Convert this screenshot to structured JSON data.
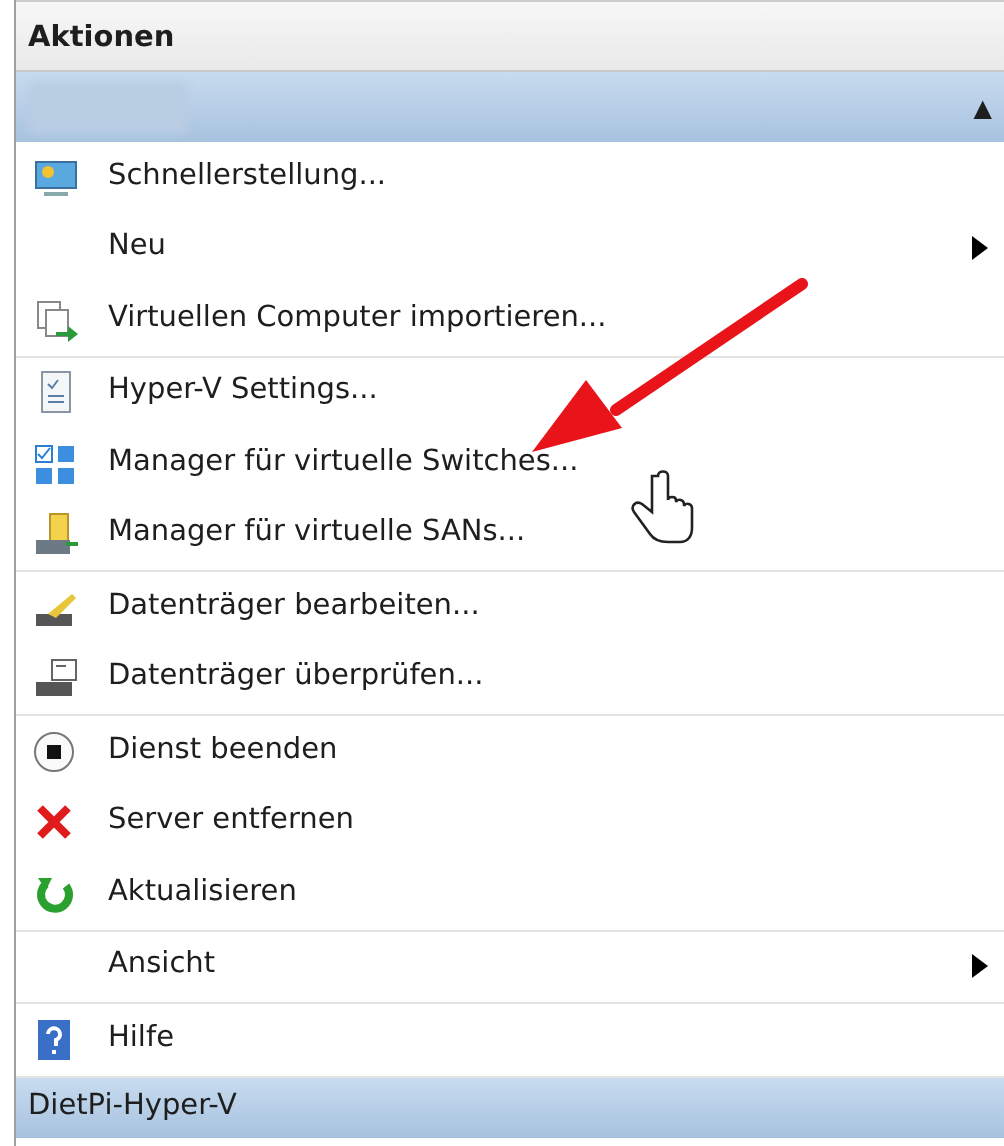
{
  "panel": {
    "title": "Aktionen"
  },
  "section": {
    "expanded": true,
    "toggle": "▲"
  },
  "groups": [
    {
      "items": [
        {
          "label": "Schnellerstellung...",
          "submenu": false
        },
        {
          "label": "Neu",
          "submenu": true
        },
        {
          "label": "Virtuellen Computer importieren...",
          "submenu": false
        }
      ]
    },
    {
      "items": [
        {
          "label": "Hyper-V Settings...",
          "submenu": false
        },
        {
          "label": "Manager für virtuelle Switches...",
          "submenu": false
        },
        {
          "label": "Manager für virtuelle SANs...",
          "submenu": false
        }
      ]
    },
    {
      "items": [
        {
          "label": "Datenträger bearbeiten...",
          "submenu": false
        },
        {
          "label": "Datenträger überprüfen...",
          "submenu": false
        }
      ]
    },
    {
      "items": [
        {
          "label": "Dienst beenden",
          "submenu": false
        },
        {
          "label": "Server entfernen",
          "submenu": false
        },
        {
          "label": "Aktualisieren",
          "submenu": false
        }
      ]
    },
    {
      "items": [
        {
          "label": "Ansicht",
          "submenu": true
        }
      ]
    },
    {
      "items": [
        {
          "label": "Hilfe",
          "submenu": false
        }
      ]
    }
  ],
  "next_section": {
    "title": "DietPi-Hyper-V"
  }
}
